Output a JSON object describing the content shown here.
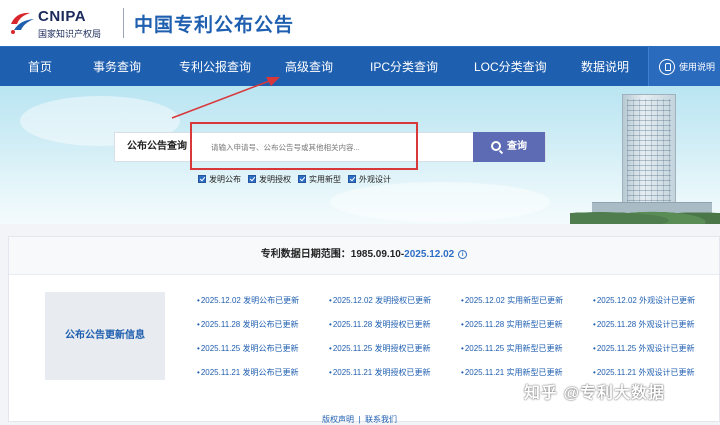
{
  "header": {
    "logo_en": "CNIPA",
    "logo_cn": "国家知识产权局",
    "site_title": "中国专利公布公告"
  },
  "nav": {
    "items": [
      "首页",
      "事务查询",
      "专利公报查询",
      "高级查询",
      "IPC分类查询",
      "LOC分类查询",
      "数据说明"
    ],
    "help_label": "使用说明"
  },
  "search": {
    "label": "公布公告查询",
    "placeholder": "请输入申请号、公布公告号或其他相关内容...",
    "button_label": "查询",
    "filters": [
      "发明公布",
      "发明授权",
      "实用新型",
      "外观设计"
    ]
  },
  "date_range": {
    "prefix": "专利数据日期范围：",
    "start": "1985.09.10",
    "separator": "-",
    "end": "2025.12.02"
  },
  "updates": {
    "title": "公布公告更新信息",
    "rows": [
      [
        "2025.12.02 发明公布已更新",
        "2025.12.02 发明授权已更新",
        "2025.12.02 实用新型已更新",
        "2025.12.02 外观设计已更新"
      ],
      [
        "2025.11.28 发明公布已更新",
        "2025.11.28 发明授权已更新",
        "2025.11.28 实用新型已更新",
        "2025.11.28 外观设计已更新"
      ],
      [
        "2025.11.25 发明公布已更新",
        "2025.11.25 发明授权已更新",
        "2025.11.25 实用新型已更新",
        "2025.11.25 外观设计已更新"
      ],
      [
        "2025.11.21 发明公布已更新",
        "2025.11.21 发明授权已更新",
        "2025.11.21 实用新型已更新",
        "2025.11.21 外观设计已更新"
      ]
    ]
  },
  "footer": {
    "links": [
      "版权声明",
      "联系我们"
    ]
  },
  "watermark": "知乎 @专利大数据",
  "colors": {
    "nav_bg": "#1e5fb0",
    "accent": "#1f5fb0",
    "search_button": "#5c6bb3",
    "annotation_red": "#d9383a"
  }
}
